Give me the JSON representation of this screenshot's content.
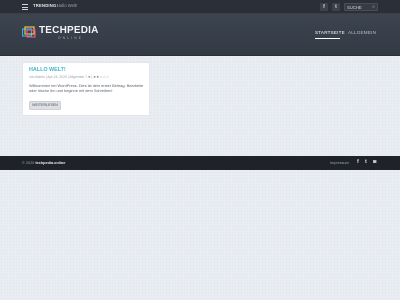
{
  "topbar": {
    "trending_label": "TRENDING:",
    "trending_post": "Hallo Welt!",
    "social": [
      {
        "icon": "facebook-icon",
        "glyph": "f"
      },
      {
        "icon": "twitter-icon",
        "glyph": "t"
      }
    ],
    "search_placeholder": "SUCHE"
  },
  "header": {
    "logo_title": "TECHPEDIA",
    "logo_sub": "ONLINE",
    "nav": [
      {
        "label": "STARTSEITE",
        "active": true
      },
      {
        "label": "ALLGEMEIN",
        "active": false
      }
    ]
  },
  "post": {
    "title": "HALLO WELT!",
    "author": "von Admin",
    "date": "Apr 24, 2020",
    "category": "Allgemein",
    "comments": "7",
    "excerpt": "Willkommen bei WordPress. Dies ist dein erster Beitrag. Bearbeite oder lösche ihn und beginne mit dem Schreiben!",
    "read_more": "WEITERLESEN"
  },
  "footer": {
    "copyright_prefix": "© 2020",
    "site": "techpedia.online",
    "impressum": "Impressum",
    "social": [
      {
        "icon": "facebook-icon",
        "glyph": "f"
      },
      {
        "icon": "twitter-icon",
        "glyph": "t"
      },
      {
        "icon": "instagram-icon",
        "glyph": "◙"
      }
    ]
  },
  "colors": {
    "accent": "#3fb4d2",
    "topbar": "#2b3038",
    "header": "#38404b",
    "footer": "#1f2329",
    "page_bg": "#e9edf2"
  }
}
